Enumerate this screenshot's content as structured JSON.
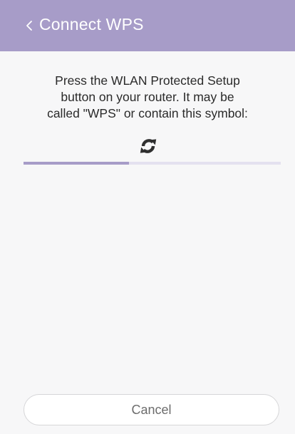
{
  "header": {
    "title": "Connect WPS",
    "back_icon": "chevron-left-icon",
    "background": "#a79cc8"
  },
  "main": {
    "message_lines": [
      "Press the WLAN Protected Setup",
      "button on your router. It may be",
      "called \"WPS\" or contain this symbol:"
    ],
    "wps_icon": "wps-symbol-icon",
    "progress": 0.41,
    "progress_color": "#a79cc8"
  },
  "footer": {
    "cancel_label": "Cancel"
  }
}
